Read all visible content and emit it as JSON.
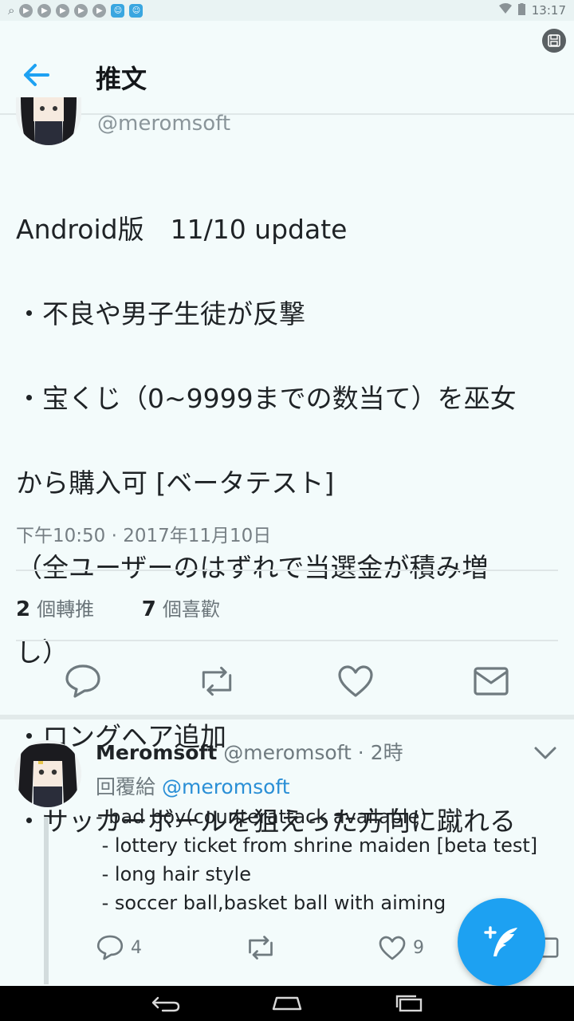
{
  "status_bar": {
    "time": "13:17"
  },
  "app_bar": {
    "title": "推文"
  },
  "tweet": {
    "handle": "@meromsoft",
    "lines": [
      "Android版　11/10 update",
      "・不良や男子生徒が反撃",
      "・宝くじ（0~9999までの数当て）を巫女",
      "から購入可 [ベータテスト]",
      "（全ユーザーのはずれで当選金が積み増",
      "し）",
      "・ロングヘア追加",
      "・サッカーボールを狙えった方向に蹴れる"
    ],
    "time": "下午10:50 · 2017年11月10日",
    "retweets_count": "2",
    "retweets_label": "個轉推",
    "likes_count": "7",
    "likes_label": "個喜歡"
  },
  "reply": {
    "name": "Meromsoft",
    "handle": "@meromsoft",
    "time": "· 2時",
    "reply_prefix": "回覆給",
    "reply_to": "@meromsoft",
    "text": "- bad boy(counterattack available)\n - lottery ticket from shrine maiden [beta test]\n - long hair style\n - soccer ball,basket ball with aiming",
    "reply_count": "4",
    "like_count": "9"
  },
  "colors": {
    "accent": "#1da1f2",
    "background": "#f3fbfb"
  }
}
